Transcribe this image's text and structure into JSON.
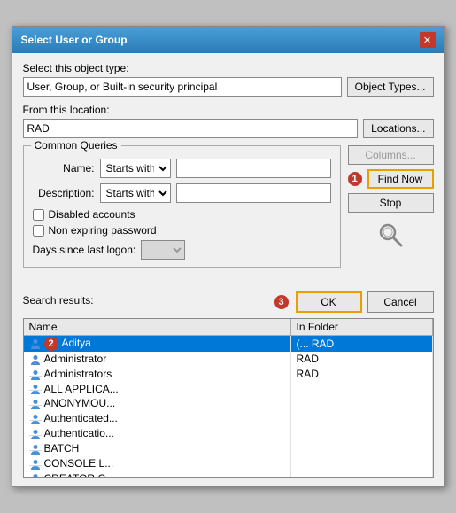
{
  "dialog": {
    "title": "Select User or Group",
    "close_label": "✕"
  },
  "object_type_label": "Select this object type:",
  "object_type_value": "User, Group, or Built-in security principal",
  "object_types_btn": "Object Types...",
  "location_label": "From this location:",
  "location_value": "RAD",
  "locations_btn": "Locations...",
  "common_queries_tab": "Common Queries",
  "name_label": "Name:",
  "description_label": "Description:",
  "starts_with_1": "Starts with",
  "starts_with_2": "Starts with",
  "disabled_accounts_label": "Disabled accounts",
  "non_expiring_label": "Non expiring password",
  "days_label": "Days since last logon:",
  "columns_btn": "Columns...",
  "find_now_btn": "Find Now",
  "stop_btn": "Stop",
  "search_results_label": "Search results:",
  "ok_btn": "OK",
  "cancel_btn": "Cancel",
  "step1": "1",
  "step2": "2",
  "step3": "3",
  "table": {
    "headers": [
      "Name",
      "In Folder"
    ],
    "rows": [
      {
        "name": "Aditya",
        "folder": "(... RAD",
        "selected": true
      },
      {
        "name": "Administrator",
        "folder": "RAD",
        "selected": false
      },
      {
        "name": "Administrators",
        "folder": "RAD",
        "selected": false
      },
      {
        "name": "ALL APPLICA...",
        "folder": "",
        "selected": false
      },
      {
        "name": "ANONYMOU...",
        "folder": "",
        "selected": false
      },
      {
        "name": "Authenticated...",
        "folder": "",
        "selected": false
      },
      {
        "name": "Authenticatio...",
        "folder": "",
        "selected": false
      },
      {
        "name": "BATCH",
        "folder": "",
        "selected": false
      },
      {
        "name": "CONSOLE L...",
        "folder": "",
        "selected": false
      },
      {
        "name": "CREATOR G...",
        "folder": "",
        "selected": false
      }
    ]
  }
}
